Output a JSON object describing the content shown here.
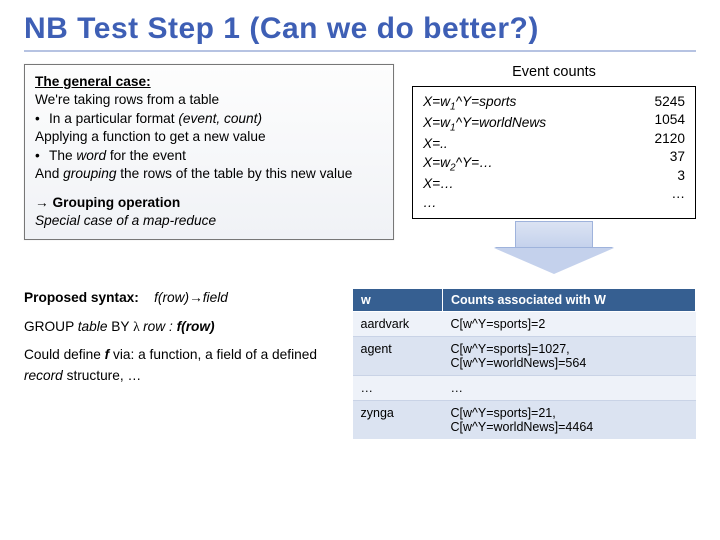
{
  "title": "NB Test Step 1 (Can we do better?)",
  "general": {
    "heading": "The general case:",
    "l1": "We're taking rows from a table",
    "b1_pre": "In a particular format ",
    "b1_em": "(event, count)",
    "l2": "Applying a function to get a new value",
    "b2_pre": "The ",
    "b2_em": "word",
    "b2_post": " for the event",
    "l3_pre": "And ",
    "l3_em": "grouping",
    "l3_post": " the rows of the table by this new value",
    "grp_arrow": "→",
    "grp_bold": "Grouping operation",
    "grp_sub": "Special case of a map-reduce"
  },
  "events": {
    "title": "Event counts",
    "left": [
      "X=w",
      "^Y=sports",
      "X=w",
      "^Y=worldNews",
      "X=..",
      "X=w",
      "^Y=…",
      "X=…",
      "…"
    ],
    "sub1": "1",
    "sub1b": "1",
    "sub2": "2",
    "right": [
      "5245",
      "1054",
      "2120",
      "37",
      "3",
      "…"
    ]
  },
  "bottom_left": {
    "proposed_label": "Proposed syntax:",
    "proposed_value": "f(row)→field",
    "group_pre": "GROUP ",
    "group_tbl": "table",
    "group_by": " BY ",
    "group_lambda": "λ ",
    "group_rowcolon": "row : ",
    "group_f": "f(row)",
    "couldline_pre": "Could define ",
    "couldline_f": "f",
    "couldline_mid": " via: a function, a field of a defined ",
    "couldline_rec": "record",
    "couldline_post": " structure, …"
  },
  "table": {
    "h1": "w",
    "h2": "Counts associated with W",
    "rows": [
      {
        "w": "aardvark",
        "c": "C[w^Y=sports]=2"
      },
      {
        "w": "agent",
        "c": "C[w^Y=sports]=1027, C[w^Y=worldNews]=564"
      },
      {
        "w": "…",
        "c": "…"
      },
      {
        "w": "zynga",
        "c": "C[w^Y=sports]=21, C[w^Y=worldNews]=4464"
      }
    ]
  }
}
